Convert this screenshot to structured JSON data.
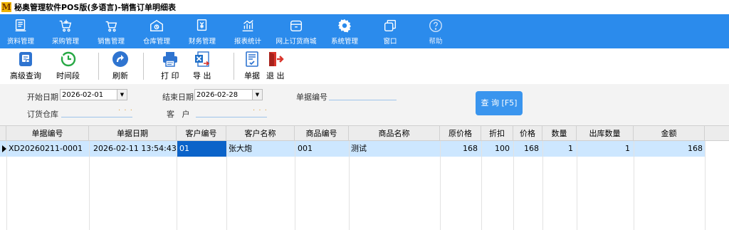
{
  "window": {
    "title": "秘奥管理软件POS版(多语言)-销售订单明细表"
  },
  "menu": [
    {
      "label": "资料管理",
      "icon": "document-icon"
    },
    {
      "label": "采购管理",
      "icon": "cart-icon"
    },
    {
      "label": "销售管理",
      "icon": "basket-icon"
    },
    {
      "label": "仓库管理",
      "icon": "warehouse-icon"
    },
    {
      "label": "财务管理",
      "icon": "finance-icon"
    },
    {
      "label": "报表统计",
      "icon": "chart-icon"
    },
    {
      "label": "网上订货商城",
      "icon": "shop-icon"
    },
    {
      "label": "系统管理",
      "icon": "gear-icon"
    },
    {
      "label": "窗口",
      "icon": "window-icon"
    },
    {
      "label": "帮助",
      "icon": "help-icon"
    }
  ],
  "toolbar": {
    "advanced_search": "高级查询",
    "time_period": "时间段",
    "refresh": "刷新",
    "print": "打 印",
    "export": "导 出",
    "document": "单据",
    "exit": "退 出"
  },
  "filter": {
    "start_date_label": "开始日期",
    "start_date": "2026-02-01",
    "end_date_label": "结束日期",
    "end_date": "2026-02-28",
    "doc_no_label": "单据编号",
    "warehouse_label": "订货仓库",
    "customer_label": "客   户",
    "dots": "· · ·",
    "search_button": "查 询 [F5]"
  },
  "table": {
    "columns": [
      "单据编号",
      "单据日期",
      "客户编号",
      "客户名称",
      "商品编号",
      "商品名称",
      "原价格",
      "折扣",
      "价格",
      "数量",
      "出库数量",
      "金额"
    ],
    "rows": [
      [
        "XD20260211-0001",
        "2026-02-11 13:54:43",
        "01",
        "张大炮",
        "001",
        "测试",
        "168",
        "100",
        "168",
        "1",
        "1",
        "168"
      ]
    ]
  }
}
